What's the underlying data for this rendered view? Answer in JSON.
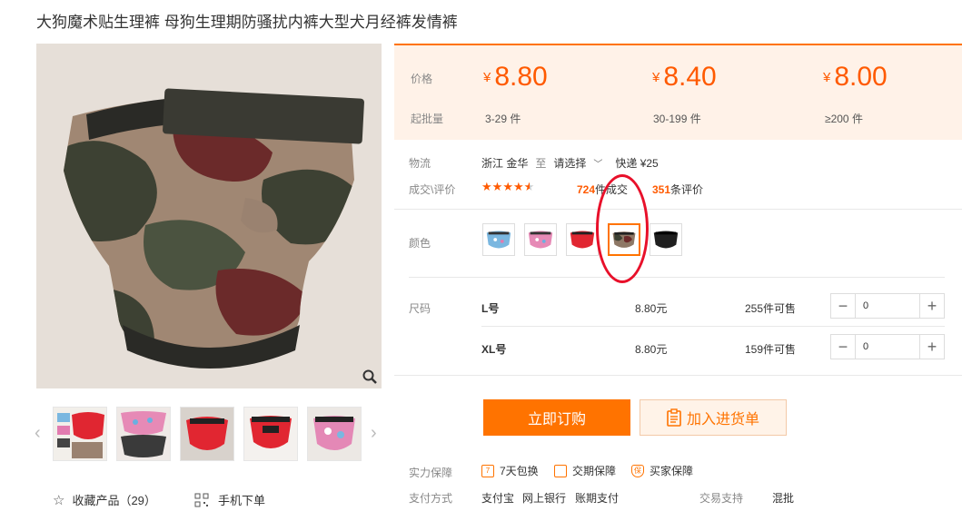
{
  "title": "大狗魔术贴生理裤 母狗生理期防骚扰内裤大型犬月经裤发情裤",
  "price_table": {
    "price_label": "价格",
    "moq_label": "起批量",
    "currency": "¥",
    "tiers": [
      {
        "price": "8.80",
        "range": "3-29 件"
      },
      {
        "price": "8.40",
        "range": "30-199 件"
      },
      {
        "price": "8.00",
        "range": "≥200 件"
      }
    ]
  },
  "logistics": {
    "label": "物流",
    "from": "浙江 金华",
    "to_word": "至",
    "destination": "请选择",
    "express": "快递 ¥25"
  },
  "rating": {
    "label": "成交\\评价",
    "stars": 4.5,
    "deals_count": "724",
    "deals_suffix": "件成交",
    "reviews_count": "351",
    "reviews_suffix": "条评价"
  },
  "colors": {
    "label": "颜色",
    "swatches": [
      "blue-print",
      "pink-print",
      "red",
      "camo",
      "black"
    ],
    "selected_index": 3
  },
  "sizes": {
    "label": "尺码",
    "rows": [
      {
        "name": "L号",
        "price": "8.80元",
        "stock": "255件可售",
        "qty": "0"
      },
      {
        "name": "XL号",
        "price": "8.80元",
        "stock": "159件可售",
        "qty": "0"
      }
    ]
  },
  "actions": {
    "order_label": "立即订购",
    "cart_label": "加入进货单"
  },
  "guarantee": {
    "label": "实力保障",
    "items": [
      "7天包换",
      "交期保障",
      "买家保障"
    ],
    "icon_text": [
      "7",
      "",
      "保"
    ]
  },
  "payment": {
    "label": "支付方式",
    "methods": [
      "支付宝",
      "网上银行",
      "账期支付"
    ],
    "trade_label": "交易支持",
    "trade_value": "混批"
  },
  "gallery": {
    "favorite_label": "收藏产品（29）",
    "mobile_label": "手机下单"
  },
  "colors_palette": {
    "accent": "#ff7300",
    "price": "#ff5a00",
    "highlight": "#e8102a"
  }
}
